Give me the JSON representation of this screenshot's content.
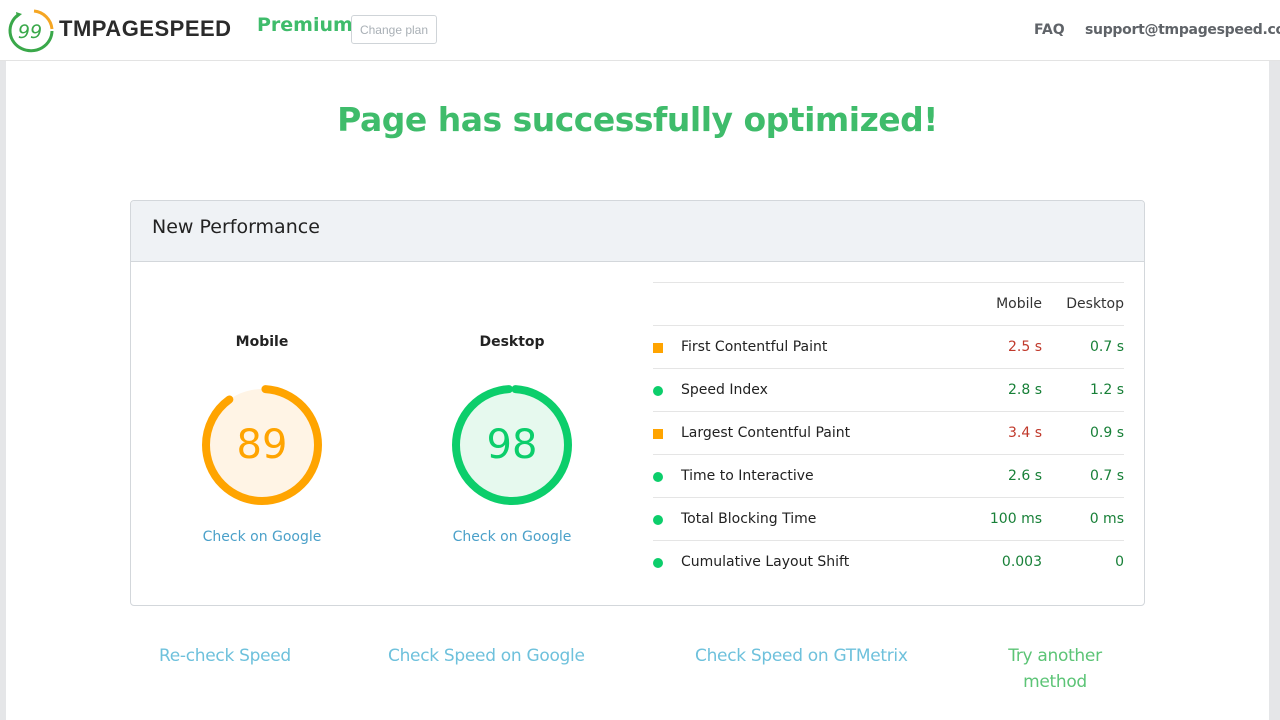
{
  "header": {
    "logo_number": "99",
    "logo_text": "TMPAGESPEED",
    "plan": "Premium",
    "change_plan_label": "Change plan",
    "nav": {
      "faq": "FAQ",
      "support": "support@tmpagespeed.com"
    }
  },
  "headline": "Page has successfully optimized!",
  "card": {
    "title": "New Performance",
    "scores": [
      {
        "label": "Mobile",
        "score": 89,
        "score_text": "89",
        "color": "#ffa400",
        "bg": "#fff4e5",
        "link": "Check on Google"
      },
      {
        "label": "Desktop",
        "score": 98,
        "score_text": "98",
        "color": "#0cce6b",
        "bg": "#e6f9ee",
        "link": "Check on Google"
      }
    ],
    "metrics": {
      "columns": [
        "Mobile",
        "Desktop"
      ],
      "rows": [
        {
          "indicator": "square",
          "label": "First Contentful Paint",
          "mobile": "2.5 s",
          "mobile_color": "#c0392b",
          "desktop": "0.7 s",
          "desktop_color": "#188038"
        },
        {
          "indicator": "circle",
          "label": "Speed Index",
          "mobile": "2.8 s",
          "mobile_color": "#188038",
          "desktop": "1.2 s",
          "desktop_color": "#188038"
        },
        {
          "indicator": "square",
          "label": "Largest Contentful Paint",
          "mobile": "3.4 s",
          "mobile_color": "#c0392b",
          "desktop": "0.9 s",
          "desktop_color": "#188038"
        },
        {
          "indicator": "circle",
          "label": "Time to Interactive",
          "mobile": "2.6 s",
          "mobile_color": "#188038",
          "desktop": "0.7 s",
          "desktop_color": "#188038"
        },
        {
          "indicator": "circle",
          "label": "Total Blocking Time",
          "mobile": "100 ms",
          "mobile_color": "#188038",
          "desktop": "0 ms",
          "desktop_color": "#188038"
        },
        {
          "indicator": "circle",
          "label": "Cumulative Layout Shift",
          "mobile": "0.003",
          "mobile_color": "#188038",
          "desktop": "0",
          "desktop_color": "#188038"
        }
      ]
    }
  },
  "actions": {
    "recheck": "Re-check Speed",
    "google": "Check Speed on Google",
    "gtmetrix": "Check Speed on GTMetrix",
    "another": "Try another method"
  }
}
